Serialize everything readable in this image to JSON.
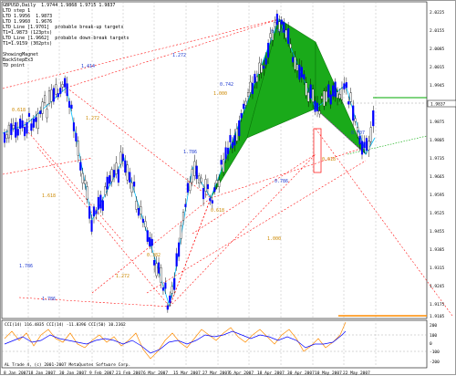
{
  "header": {
    "title": "GBPUSD,Daily  1.9744 1.9868 1.9715 1.9837",
    "lines": [
      "LTD step 1",
      "LTD 1.9956  1.9873",
      "LTD 1.9960  1.9676",
      "LTD_Line [1.9701]  probable break-up targets",
      "T1=1.9873 (123pts)",
      "LTD_Line [1.9662]  probable down-break targets",
      "T1=1.9159 (302pts)",
      "",
      "ShowingMagnet",
      "BackStepEx3",
      "TD point"
    ]
  },
  "price_axis": [
    "2.0225",
    "2.0155",
    "2.0085",
    "2.0015",
    "1.9945",
    "1.9875",
    "1.9805",
    "1.9735",
    "1.9665",
    "1.9595",
    "1.9525",
    "1.9455",
    "1.9385",
    "1.9315",
    "1.9245",
    "1.9175",
    "1.9105"
  ],
  "current_price": "1.9837",
  "date_axis": [
    "8 Jan 2007",
    "18 Jan 2007",
    "30 Jan 2007",
    "9 Feb 2007",
    "21 Feb 2007",
    "6 Mar 2007",
    "15 Mar 2007",
    "27 Mar 2007",
    "6 Apr 2007",
    "18 Apr 2007",
    "30 Apr 2007",
    "10 May 2007",
    "22 May 2007"
  ],
  "fib_labels": [
    "1.414",
    "1.272",
    "1.000",
    "0.742",
    "0.786",
    "1.786",
    "0.618",
    "1.272",
    "1.618",
    "1.786",
    "1.272",
    "1.786",
    "0.618",
    "0.786",
    "0.707",
    "1.000",
    "0.382",
    "0.618"
  ],
  "indicator": {
    "title": "CCI(14) 116.4835   CCI(14) -11.8396   CCI(50) 10.2362",
    "levels": [
      "200",
      "100",
      "0",
      "-100",
      "-200"
    ]
  },
  "copyright": "AL Trade 4, (c) 2001-2007 MetaQuotes Software Corp.",
  "colors": {
    "candle": "#0000ff",
    "wick": "#000000",
    "pattern_fill": "#1aaa1a",
    "zigzag": "#00bfff",
    "fib_lines": "#ff0000",
    "target_line_up": "#00aa00",
    "target_line_down": "#ff8c00",
    "cci_fast": "#ff8c00",
    "cci_slow": "#0000ff"
  }
}
